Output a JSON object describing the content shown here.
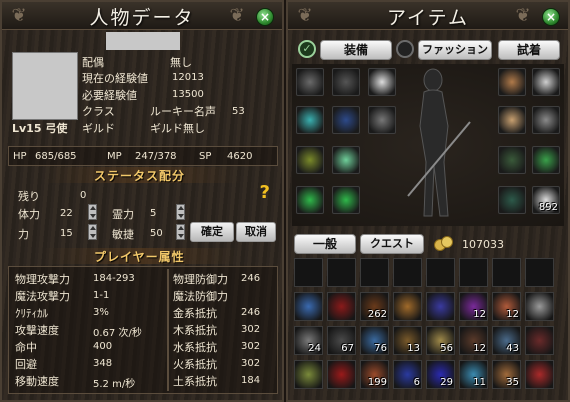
{
  "character_panel": {
    "title": "人物データ",
    "level_class": "Lv15 弓使",
    "info": [
      {
        "label": "配偶",
        "value": "無し"
      },
      {
        "label": "現在の経験値",
        "value": "12013"
      },
      {
        "label": "必要経験値",
        "value": "13500"
      },
      {
        "label": "クラス",
        "value": "ルーキー名声",
        "extra": "53"
      },
      {
        "label": "ギルド",
        "value": "ギルド無し"
      }
    ],
    "vitals": {
      "hp_label": "HP",
      "hp": "685/685",
      "mp_label": "MP",
      "mp": "247/378",
      "sp_label": "SP",
      "sp": "4620"
    },
    "stat_alloc": {
      "header": "ステータス配分",
      "remaining_label": "残り",
      "remaining": "0",
      "help": "?",
      "stats": [
        {
          "label": "体力",
          "value": "22"
        },
        {
          "label": "霊力",
          "value": "5"
        },
        {
          "label": "力",
          "value": "15"
        },
        {
          "label": "敏捷",
          "value": "50"
        }
      ],
      "confirm": "確定",
      "cancel": "取消"
    },
    "attributes": {
      "header": "プレイヤー属性",
      "left": [
        {
          "label": "物理攻撃力",
          "value": "184-293"
        },
        {
          "label": "魔法攻撃力",
          "value": "1-1"
        },
        {
          "label": "ｸﾘﾃｨｶﾙ",
          "value": "3%"
        },
        {
          "label": "攻撃速度",
          "value": "0.67 次/秒"
        },
        {
          "label": "命中",
          "value": "400"
        },
        {
          "label": "回避",
          "value": "348"
        },
        {
          "label": "移動速度",
          "value": "5.2 m/秒"
        }
      ],
      "right": [
        {
          "label": "物理防御力",
          "value": "246"
        },
        {
          "label": "魔法防御力",
          "value": ""
        },
        {
          "label": "金系抵抗",
          "value": "246"
        },
        {
          "label": "木系抵抗",
          "value": "302"
        },
        {
          "label": "水系抵抗",
          "value": "302"
        },
        {
          "label": "火系抵抗",
          "value": "302"
        },
        {
          "label": "土系抵抗",
          "value": "184"
        }
      ]
    }
  },
  "item_panel": {
    "title": "アイテム",
    "tabs": {
      "equip": "装備",
      "fashion": "ファッション",
      "try_on": "試着"
    },
    "equip_slots_left": [
      "helmet-icon",
      "armor-icon",
      "wing-icon",
      "necklace-icon",
      "cape-icon",
      "tome-icon",
      "bow-icon",
      "jade-icon",
      "ring-icon",
      "ring-icon"
    ],
    "equip_slots_right": [
      "face-icon",
      "sword-icon",
      "amulet-icon",
      "talisman-icon",
      "boots-icon",
      "leaf-icon",
      "gauntlet-icon",
      "arrow-icon"
    ],
    "arrow_count": "892",
    "inv_tabs": {
      "general": "一般",
      "quest": "クエスト"
    },
    "money_icon": "coin-icon",
    "money": "107033",
    "inventory_row1_counts": [
      "",
      "",
      "262",
      "",
      "",
      "12",
      "12",
      ""
    ],
    "inventory_row2_counts": [
      "24",
      "67",
      "76",
      "13",
      "56",
      "12",
      "43",
      ""
    ],
    "inventory_row3_counts": [
      "",
      "",
      "199",
      "6",
      "29",
      "11",
      "35",
      ""
    ]
  },
  "colors": {
    "accent": "#f2c86a",
    "close_green": "#2f8a2f"
  }
}
